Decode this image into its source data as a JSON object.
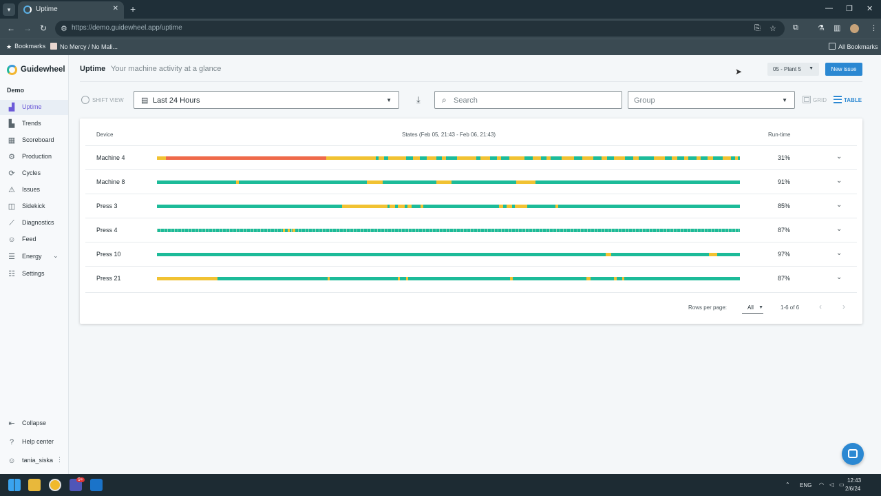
{
  "browser": {
    "tab_title": "Uptime",
    "url_host": "https://demo.guidewheel.app",
    "url_path": "/uptime",
    "bookmarks": [
      "Bookmarks",
      "No Mercy / No Mali...",
      "All Bookmarks"
    ]
  },
  "sidebar": {
    "brand": "Guidewheel",
    "workspace": "Demo",
    "items": [
      {
        "label": "Uptime",
        "icon": "chart-icon",
        "active": true
      },
      {
        "label": "Trends",
        "icon": "trends-icon"
      },
      {
        "label": "Scoreboard",
        "icon": "grid-icon"
      },
      {
        "label": "Production",
        "icon": "gear-icon"
      },
      {
        "label": "Cycles",
        "icon": "cycle-icon"
      },
      {
        "label": "Issues",
        "icon": "warning-icon"
      },
      {
        "label": "Sidekick",
        "icon": "sidekick-icon"
      },
      {
        "label": "Diagnostics",
        "icon": "diagnostics-icon"
      },
      {
        "label": "Feed",
        "icon": "people-icon"
      },
      {
        "label": "Energy",
        "icon": "list-icon"
      },
      {
        "label": "Settings",
        "icon": "sliders-icon"
      }
    ],
    "footer": [
      "Collapse",
      "Help center",
      "tania_siska"
    ]
  },
  "header": {
    "title": "Uptime",
    "subtitle": "Your machine activity at a glance",
    "plant": "05 - Plant 5",
    "new_issue": "New issue"
  },
  "filters": {
    "shift_view": "SHIFT VIEW",
    "period": "Last 24 Hours",
    "search_placeholder": "Search",
    "group_placeholder": "Group",
    "grid_label": "GRID",
    "table_label": "TABLE"
  },
  "table": {
    "col_device": "Device",
    "col_states": "States (Feb 05, 21:43 - Feb 06, 21:43)",
    "col_runtime": "Run-time",
    "rows": [
      {
        "device": "Machine 4",
        "runtime": "31%"
      },
      {
        "device": "Machine 8",
        "runtime": "91%"
      },
      {
        "device": "Press 3",
        "runtime": "85%"
      },
      {
        "device": "Press 4",
        "runtime": "87%"
      },
      {
        "device": "Press 10",
        "runtime": "97%"
      },
      {
        "device": "Press 21",
        "runtime": "87%"
      }
    ],
    "rows_per_page_label": "Rows per page:",
    "rows_per_page": "All",
    "range": "1-6 of 6"
  },
  "colors": {
    "running": "#1dbb99",
    "idle": "#f1c232",
    "down": "#ef6a4a",
    "accent": "#2b88d2"
  },
  "taskbar": {
    "lang": "ENG",
    "time": "12:43",
    "date": "2/6/24",
    "badge": "9+"
  }
}
